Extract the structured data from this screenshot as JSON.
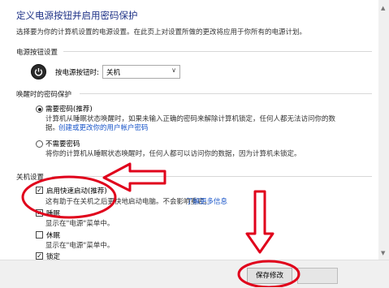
{
  "header": {
    "title": "定义电源按钮并启用密码保护",
    "subtitle": "选择要为你的计算机设置的电源设置。在此页上对设置所做的更改将应用于你所有的电源计划。"
  },
  "power_button": {
    "section_label": "电源按钮设置",
    "field_label": "按电源按钮时:",
    "selected_value": "关机"
  },
  "wake_password": {
    "section_label": "唤醒时的密码保护",
    "require": {
      "label": "需要密码(推荐)",
      "desc": "计算机从睡眠状态唤醒时，如果未输入正确的密码来解除计算机锁定，任何人都无法访问你的数",
      "desc2": "据。",
      "link": "创建或更改你的用户帐户密码"
    },
    "no_password": {
      "label": "不需要密码",
      "desc": "将你的计算机从睡眠状态唤醒时，任何人都可以访问你的数据，因为计算机未锁定。"
    }
  },
  "shutdown": {
    "section_label": "关机设置",
    "fast_startup": {
      "label": "启用快速启动(推荐)",
      "desc": "这有助于在关机之后更快地启动电脑。不会影响重启。",
      "link": "了解更多信息"
    },
    "sleep": {
      "label": "睡眠",
      "desc": "显示在\"电源\"菜单中。"
    },
    "hibernate": {
      "label": "休眠",
      "desc": "显示在\"电源\"菜单中。"
    },
    "lock": {
      "label": "锁定"
    }
  },
  "footer": {
    "save_label": "保存修改"
  },
  "colors": {
    "annotation": "#e0001b",
    "title": "#1e3287",
    "link": "#1a56c9"
  }
}
